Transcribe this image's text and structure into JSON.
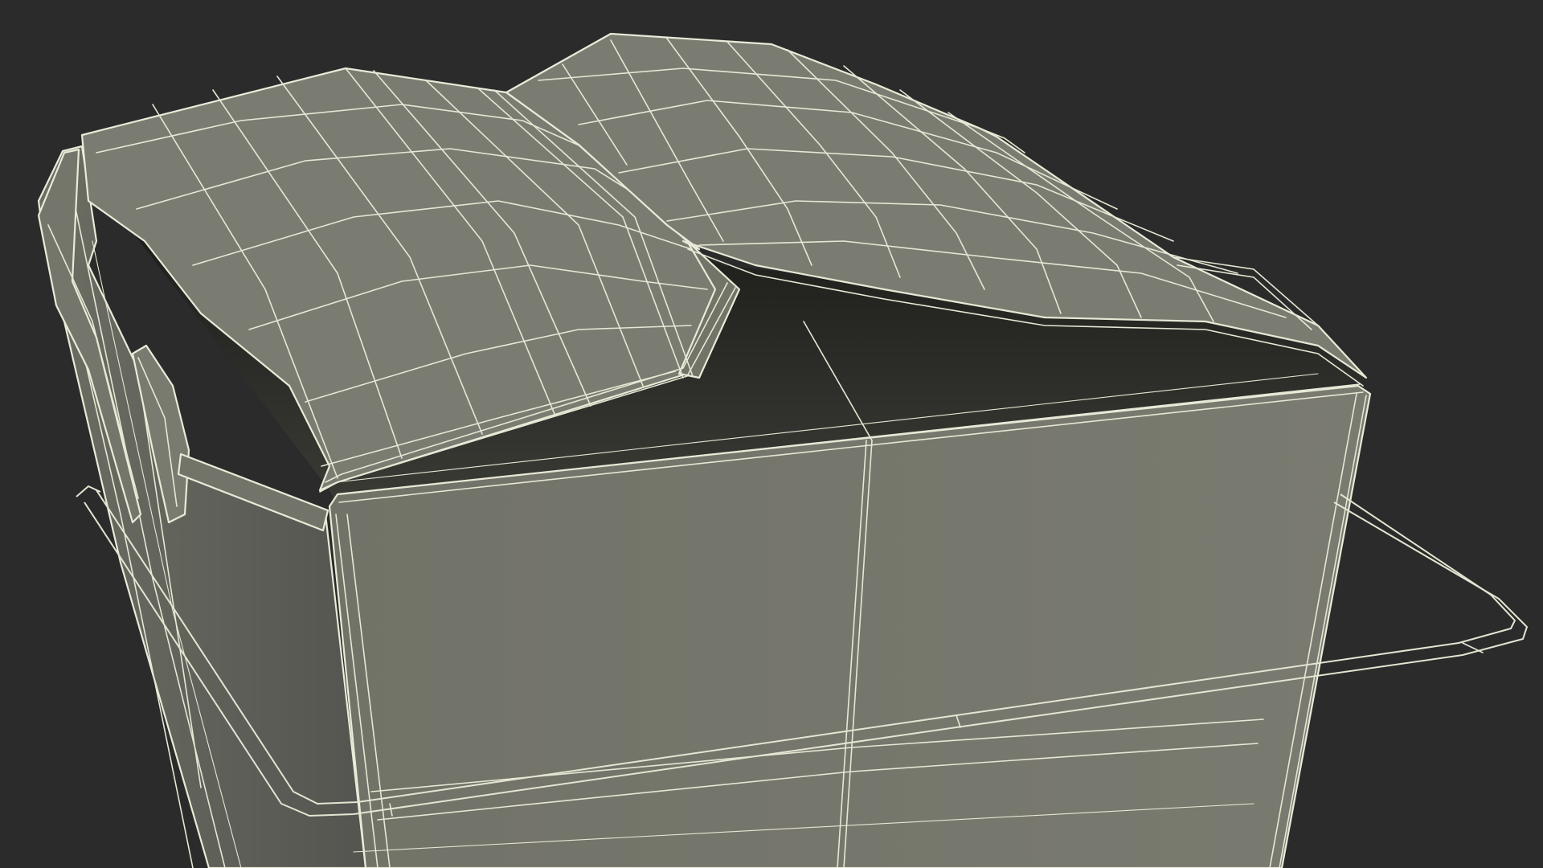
{
  "scene": {
    "subject": "wireframe-takeout-box",
    "colors": {
      "background": "#2b2b2b",
      "surface": "#76776c",
      "surface_light": "#7e7f73",
      "surface_dark": "#686960",
      "interior": "#1f201d",
      "wire": "#e6e7d4"
    }
  }
}
